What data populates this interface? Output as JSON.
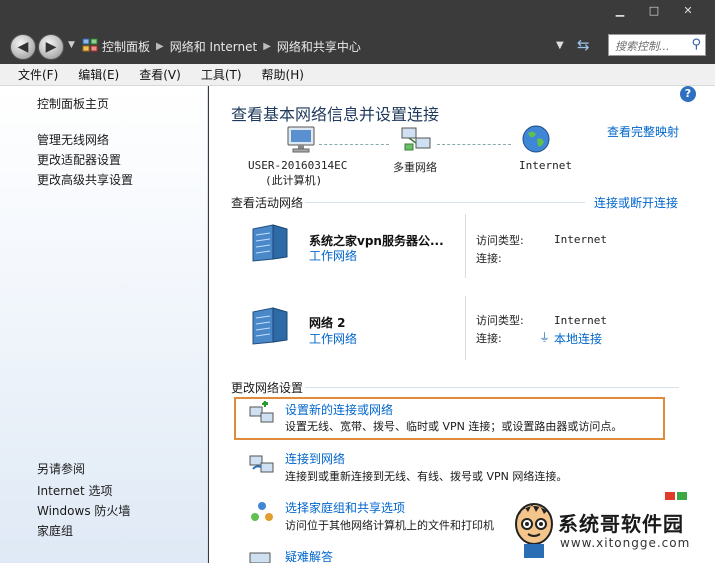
{
  "window": {
    "minimize": "▁",
    "maximize": "□",
    "close": "✕"
  },
  "nav": {
    "breadcrumb": [
      "控制面板",
      "网络和 Internet",
      "网络和共享中心"
    ],
    "search_placeholder": "搜索控制...",
    "refresh_icon": "refresh-icon"
  },
  "menu": [
    "文件(F)",
    "编辑(E)",
    "查看(V)",
    "工具(T)",
    "帮助(H)"
  ],
  "sidebar": {
    "home": "控制面板主页",
    "links": [
      "管理无线网络",
      "更改适配器设置",
      "更改高级共享设置"
    ],
    "see_also_title": "另请参阅",
    "see_also": [
      "Internet 选项",
      "Windows 防火墙",
      "家庭组"
    ]
  },
  "main": {
    "title": "查看基本网络信息并设置连接",
    "full_map": "查看完整映射",
    "nodes": [
      {
        "label1": "USER-20160314EC",
        "label2": "(此计算机)",
        "icon": "computer-icon"
      },
      {
        "label1": "多重网络",
        "label2": "",
        "icon": "multiple-networks-icon"
      },
      {
        "label1": "Internet",
        "label2": "",
        "icon": "globe-icon"
      }
    ],
    "active_title": "查看活动网络",
    "connect_link": "连接或断开连接",
    "networks": [
      {
        "name": "系统之家vpn服务器公...",
        "type": "工作网络",
        "access_label": "访问类型:",
        "access": "Internet",
        "conn_label": "连接:",
        "conn": ""
      },
      {
        "name": "网络  2",
        "type": "工作网络",
        "access_label": "访问类型:",
        "access": "Internet",
        "conn_label": "连接:",
        "conn": "本地连接"
      }
    ],
    "change_title": "更改网络设置",
    "tasks": [
      {
        "title": "设置新的连接或网络",
        "desc": "设置无线、宽带、拨号、临时或 VPN 连接；或设置路由器或访问点。"
      },
      {
        "title": "连接到网络",
        "desc": "连接到或重新连接到无线、有线、拨号或 VPN 网络连接。"
      },
      {
        "title": "选择家庭组和共享选项",
        "desc": "访问位于其他网络计算机上的文件和打印机"
      },
      {
        "title": "疑难解答",
        "desc": ""
      }
    ]
  },
  "watermark": {
    "text": "系统哥软件园",
    "url": "www.xitongge.com"
  },
  "colors": {
    "link": "#0066cc",
    "title": "#1e395b",
    "highlight": "#e08a3c"
  }
}
